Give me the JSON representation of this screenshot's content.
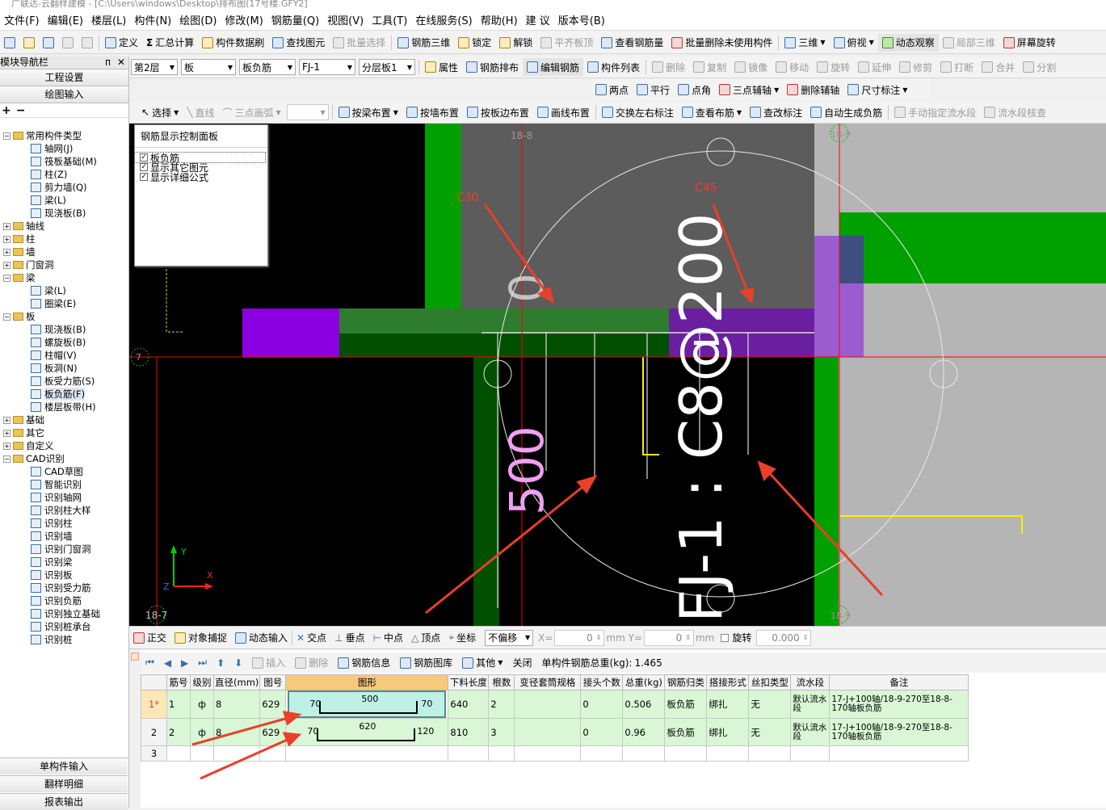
{
  "title": "广联达-云翻样建模 - [C:\\Users\\windows\\Desktop\\排布图(17号楼.GFY2]",
  "menu": [
    "文件(F)",
    "编辑(E)",
    "楼层(L)",
    "构件(N)",
    "绘图(D)",
    "修改(M)",
    "钢筋量(Q)",
    "视图(V)",
    "工具(T)",
    "在线服务(S)",
    "帮助(H)",
    "建 议",
    "版本号(B)"
  ],
  "toolbar1": [
    {
      "label": "定义",
      "icon": "define-icon"
    },
    {
      "label": "汇总计算",
      "icon": "sigma-icon"
    },
    {
      "label": "构件数据刷",
      "icon": "brush-icon"
    },
    {
      "label": "查找图元",
      "icon": "binoculars-icon"
    },
    {
      "label": "批量选择",
      "icon": "batch-select-icon",
      "disabled": true
    },
    {
      "label": "钢筋三维",
      "icon": "rebar-3d-icon"
    },
    {
      "label": "锁定",
      "icon": "lock-icon"
    },
    {
      "label": "解锁",
      "icon": "unlock-icon"
    },
    {
      "label": "平齐板顶",
      "icon": "align-top-icon",
      "disabled": true
    },
    {
      "label": "查看钢筋量",
      "icon": "view-rebar-icon"
    },
    {
      "label": "批量删除未使用构件",
      "icon": "batch-delete-icon"
    },
    {
      "label": "三维",
      "icon": "cube-icon"
    },
    {
      "label": "俯视",
      "icon": "top-view-icon"
    },
    {
      "label": "动态观察",
      "icon": "orbit-icon"
    },
    {
      "label": "局部三维",
      "icon": "local-3d-icon",
      "disabled": true
    },
    {
      "label": "屏幕旋转",
      "icon": "screen-rotate-icon"
    }
  ],
  "selectors": {
    "floor": "第2层",
    "category": "板",
    "type": "板负筋",
    "name": "FJ-1",
    "layer": "分层板1"
  },
  "toolbar2": [
    {
      "label": "属性",
      "icon": "properties-icon"
    },
    {
      "label": "钢筋排布",
      "icon": "rebar-layout-icon"
    },
    {
      "label": "编辑钢筋",
      "icon": "edit-rebar-icon"
    },
    {
      "label": "构件列表",
      "icon": "component-list-icon"
    }
  ],
  "toolbar2_right": [
    {
      "label": "删除",
      "icon": "delete-icon"
    },
    {
      "label": "复制",
      "icon": "copy-icon"
    },
    {
      "label": "镜像",
      "icon": "mirror-icon"
    },
    {
      "label": "移动",
      "icon": "move-icon"
    },
    {
      "label": "旋转",
      "icon": "rotate-icon"
    },
    {
      "label": "延伸",
      "icon": "extend-icon"
    },
    {
      "label": "修剪",
      "icon": "trim-icon"
    },
    {
      "label": "打断",
      "icon": "break-icon"
    },
    {
      "label": "合并",
      "icon": "merge-icon"
    },
    {
      "label": "分割",
      "icon": "split-icon"
    }
  ],
  "toolbar3": [
    {
      "label": "两点",
      "icon": "two-point-axis-icon"
    },
    {
      "label": "平行",
      "icon": "parallel-icon"
    },
    {
      "label": "点角",
      "icon": "point-angle-icon"
    },
    {
      "label": "三点辅轴",
      "icon": "three-point-axis-icon"
    },
    {
      "label": "删除辅轴",
      "icon": "delete-axis-icon"
    },
    {
      "label": "尺寸标注",
      "icon": "dimension-icon"
    }
  ],
  "toolbar4": [
    {
      "label": "选择",
      "icon": "cursor-icon"
    },
    {
      "label": "直线",
      "icon": "line-icon",
      "disabled": true
    },
    {
      "label": "三点画弧",
      "icon": "arc-icon",
      "disabled": true
    },
    {
      "label": "按梁布置",
      "icon": "by-beam-icon"
    },
    {
      "label": "按墙布置",
      "icon": "by-wall-icon"
    },
    {
      "label": "按板边布置",
      "icon": "by-slab-edge-icon"
    },
    {
      "label": "画线布置",
      "icon": "draw-line-icon"
    },
    {
      "label": "交换左右标注",
      "icon": "swap-labels-icon"
    },
    {
      "label": "查看布筋",
      "icon": "view-layout-icon"
    },
    {
      "label": "查改标注",
      "icon": "edit-label-icon"
    },
    {
      "label": "自动生成负筋",
      "icon": "auto-neg-rebar-icon"
    },
    {
      "label": "手动指定流水段",
      "icon": "manual-segment-icon",
      "disabled": true
    },
    {
      "label": "流水段核查",
      "icon": "segment-check-icon",
      "disabled": true
    }
  ],
  "nav": {
    "title": "模块导航栏",
    "pin": "ᴨ",
    "close": "✕",
    "project_settings": "工程设置",
    "drawing_input": "绘图输入",
    "tree": [
      {
        "label": "常用构件类型",
        "level": 0,
        "folder": true,
        "open": true
      },
      {
        "label": "轴网(J)",
        "level": 1
      },
      {
        "label": "筏板基础(M)",
        "level": 1
      },
      {
        "label": "柱(Z)",
        "level": 1
      },
      {
        "label": "剪力墙(Q)",
        "level": 1
      },
      {
        "label": "梁(L)",
        "level": 1
      },
      {
        "label": "现浇板(B)",
        "level": 1
      },
      {
        "label": "轴线",
        "level": 0,
        "folder": true
      },
      {
        "label": "柱",
        "level": 0,
        "folder": true
      },
      {
        "label": "墙",
        "level": 0,
        "folder": true
      },
      {
        "label": "门窗洞",
        "level": 0,
        "folder": true
      },
      {
        "label": "梁",
        "level": 0,
        "folder": true,
        "open": true
      },
      {
        "label": "梁(L)",
        "level": 1
      },
      {
        "label": "圈梁(E)",
        "level": 1
      },
      {
        "label": "板",
        "level": 0,
        "folder": true,
        "open": true
      },
      {
        "label": "现浇板(B)",
        "level": 1
      },
      {
        "label": "螺旋板(B)",
        "level": 1
      },
      {
        "label": "柱帽(V)",
        "level": 1
      },
      {
        "label": "板洞(N)",
        "level": 1
      },
      {
        "label": "板受力筋(S)",
        "level": 1
      },
      {
        "label": "板负筋(F)",
        "level": 1,
        "selected": true
      },
      {
        "label": "楼层板带(H)",
        "level": 1
      },
      {
        "label": "基础",
        "level": 0,
        "folder": true
      },
      {
        "label": "其它",
        "level": 0,
        "folder": true
      },
      {
        "label": "自定义",
        "level": 0,
        "folder": true
      },
      {
        "label": "CAD识别",
        "level": 0,
        "folder": true,
        "open": true
      },
      {
        "label": "CAD草图",
        "level": 1
      },
      {
        "label": "智能识别",
        "level": 1
      },
      {
        "label": "识别轴网",
        "level": 1
      },
      {
        "label": "识别柱大样",
        "level": 1
      },
      {
        "label": "识别柱",
        "level": 1
      },
      {
        "label": "识别墙",
        "level": 1
      },
      {
        "label": "识别门窗洞",
        "level": 1
      },
      {
        "label": "识别梁",
        "level": 1
      },
      {
        "label": "识别板",
        "level": 1
      },
      {
        "label": "识别受力筋",
        "level": 1
      },
      {
        "label": "识别负筋",
        "level": 1
      },
      {
        "label": "识别独立基础",
        "level": 1
      },
      {
        "label": "识别桩承台",
        "level": 1
      },
      {
        "label": "识别桩",
        "level": 1
      }
    ],
    "bottom": [
      "单构件输入",
      "翻样明细",
      "报表输出"
    ]
  },
  "ctrl_panel": {
    "title": "钢筋显示控制面板",
    "items": [
      {
        "label": "板负筋",
        "checked": true
      },
      {
        "label": "显示其它图元",
        "checked": true
      },
      {
        "label": "显示详细公式",
        "checked": true
      }
    ]
  },
  "canvas": {
    "axis_labels": {
      "top_left": "18-8",
      "top_right": "18-9",
      "left_mid": "7",
      "bottom_left": "18-7",
      "bottom_right": "18-9"
    },
    "annotations": {
      "c30": "C30",
      "c45": "C45"
    },
    "rebar_label": "FJ-1 : C8@200",
    "dim_text": "500",
    "zero_text": "0",
    "axes": {
      "x": "X",
      "y": "Y",
      "z": "Z"
    }
  },
  "statusbar": {
    "items": [
      {
        "label": "正交",
        "icon": "ortho-icon"
      },
      {
        "label": "对象捕捉",
        "icon": "snap-icon"
      },
      {
        "label": "动态输入",
        "icon": "dynamic-input-icon"
      },
      {
        "label": "交点",
        "icon": "intersection-icon"
      },
      {
        "label": "垂点",
        "icon": "perpendicular-icon"
      },
      {
        "label": "中点",
        "icon": "midpoint-icon"
      },
      {
        "label": "顶点",
        "icon": "vertex-icon"
      },
      {
        "label": "坐标",
        "icon": "coordinate-icon"
      }
    ],
    "offset_mode": "不偏移",
    "x_label": "X=",
    "x_value": "0",
    "y_label": "mm Y=",
    "y_value": "0",
    "unit": "mm",
    "rotate_label": "旋转",
    "rotate_value": "0.000"
  },
  "grid_toolbar": {
    "items": [
      {
        "label": "插入",
        "icon": "insert-icon",
        "disabled": true
      },
      {
        "label": "删除",
        "icon": "delete-row-icon",
        "disabled": true
      },
      {
        "label": "钢筋信息",
        "icon": "rebar-info-icon"
      },
      {
        "label": "钢筋图库",
        "icon": "rebar-library-icon"
      },
      {
        "label": "其他",
        "icon": "other-icon"
      },
      {
        "label": "关闭",
        "icon": ""
      }
    ],
    "total_label": "单构件钢筋总重(kg):",
    "total_value": "1.465"
  },
  "table": {
    "headers": [
      "筋号",
      "级别",
      "直径(mm)",
      "图号",
      "图形",
      "下料长度",
      "根数",
      "变径套筒规格",
      "接头个数",
      "总重(kg)",
      "钢筋归类",
      "搭接形式",
      "丝扣类型",
      "流水段",
      "备注"
    ],
    "rows": [
      {
        "rownum": "1*",
        "no": "1",
        "grade": "ф",
        "dia": "8",
        "fig": "629",
        "shape_left": "70",
        "shape_mid": "500",
        "shape_right": "70",
        "cut_len": "640",
        "count": "2",
        "sleeve": "",
        "joints": "0",
        "weight": "0.506",
        "category": "板负筋",
        "lap": "绑扎",
        "thread": "无",
        "segment": "默认流水段",
        "note": "17-J+100轴/18-9-270至18-8-170轴板负筋"
      },
      {
        "rownum": "2",
        "no": "2",
        "grade": "ф",
        "dia": "8",
        "fig": "629",
        "shape_left": "70",
        "shape_mid": "620",
        "shape_right": "120",
        "cut_len": "810",
        "count": "3",
        "sleeve": "",
        "joints": "0",
        "weight": "0.96",
        "category": "板负筋",
        "lap": "绑扎",
        "thread": "无",
        "segment": "默认流水段",
        "note": "17-J+100轴/18-9-270至18-8-170轴板负筋"
      }
    ],
    "empty_row": "3"
  },
  "colors": {
    "red": "#ff0000",
    "green": "#00a000",
    "dark_green": "#005000",
    "purple": "#8a00e0",
    "violet": "#6a1fa0",
    "gray": "#5c5c5c",
    "light_gray": "#b5b5b5",
    "annotation": "#e8402a"
  }
}
